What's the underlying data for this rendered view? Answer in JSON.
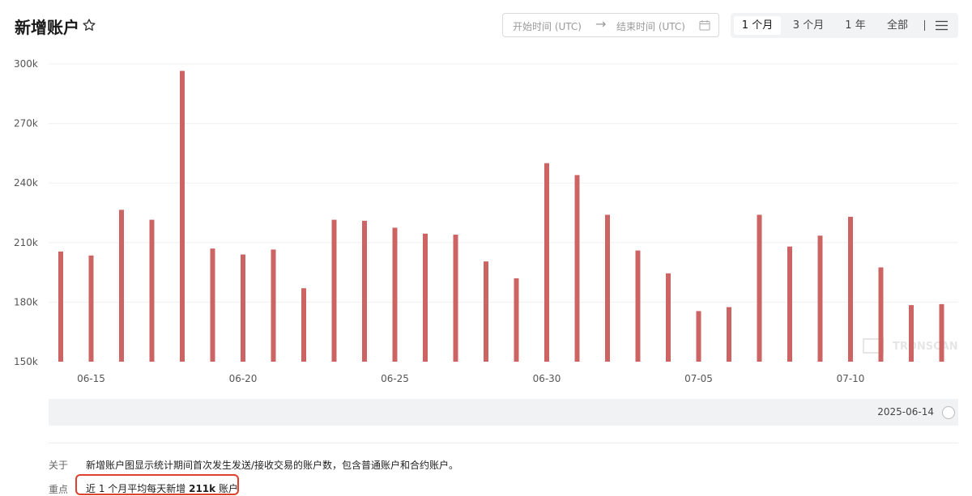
{
  "header": {
    "title": "新增账户",
    "favorite_icon": "star-outline-icon"
  },
  "date_range": {
    "start_placeholder": "开始时间 (UTC)",
    "arrow": "→",
    "end_placeholder": "结束时间 (UTC)",
    "calendar_icon": "calendar-icon"
  },
  "range_tabs": {
    "items": [
      "1 个月",
      "3 个月",
      "1 年",
      "全部"
    ],
    "active": "1 个月",
    "menu_icon": "hamburger-menu-icon"
  },
  "chart_data": {
    "type": "bar",
    "color": "#cd6464",
    "ylim": [
      150000,
      300000
    ],
    "y_ticks": [
      {
        "value": 150000,
        "label": "150k"
      },
      {
        "value": 180000,
        "label": "180k"
      },
      {
        "value": 210000,
        "label": "210k"
      },
      {
        "value": 240000,
        "label": "240k"
      },
      {
        "value": 270000,
        "label": "270k"
      },
      {
        "value": 300000,
        "label": "300k"
      }
    ],
    "x_tick_labels": [
      "06-15",
      "06-20",
      "06-25",
      "06-30",
      "07-05",
      "07-10"
    ],
    "categories": [
      "06-14",
      "06-15",
      "06-16",
      "06-17",
      "06-18",
      "06-19",
      "06-20",
      "06-21",
      "06-22",
      "06-23",
      "06-24",
      "06-25",
      "06-26",
      "06-27",
      "06-28",
      "06-29",
      "06-30",
      "07-01",
      "07-02",
      "07-03",
      "07-04",
      "07-05",
      "07-06",
      "07-07",
      "07-08",
      "07-09",
      "07-10",
      "07-11",
      "07-12",
      "07-13",
      "07-14"
    ],
    "values": [
      205500,
      203500,
      226500,
      221500,
      296500,
      207000,
      204000,
      206500,
      187000,
      221500,
      221000,
      217500,
      214500,
      214000,
      200500,
      192000,
      250000,
      244000,
      224000,
      206000,
      194500,
      175500,
      177500,
      224000,
      208000,
      213500,
      223000,
      197500,
      178500,
      179000,
      0
    ],
    "watermark": "TRONSCAN"
  },
  "slider": {
    "date_label": "2025-06-14"
  },
  "about": {
    "label": "关于",
    "text": "新增账户图显示统计期间首次发生发送/接收交易的账户数，包含普通账户和合约账户。"
  },
  "key_point": {
    "label": "重点",
    "prefix": "近 1 个月平均每天新增 ",
    "value": "211k",
    "suffix": " 账户"
  }
}
